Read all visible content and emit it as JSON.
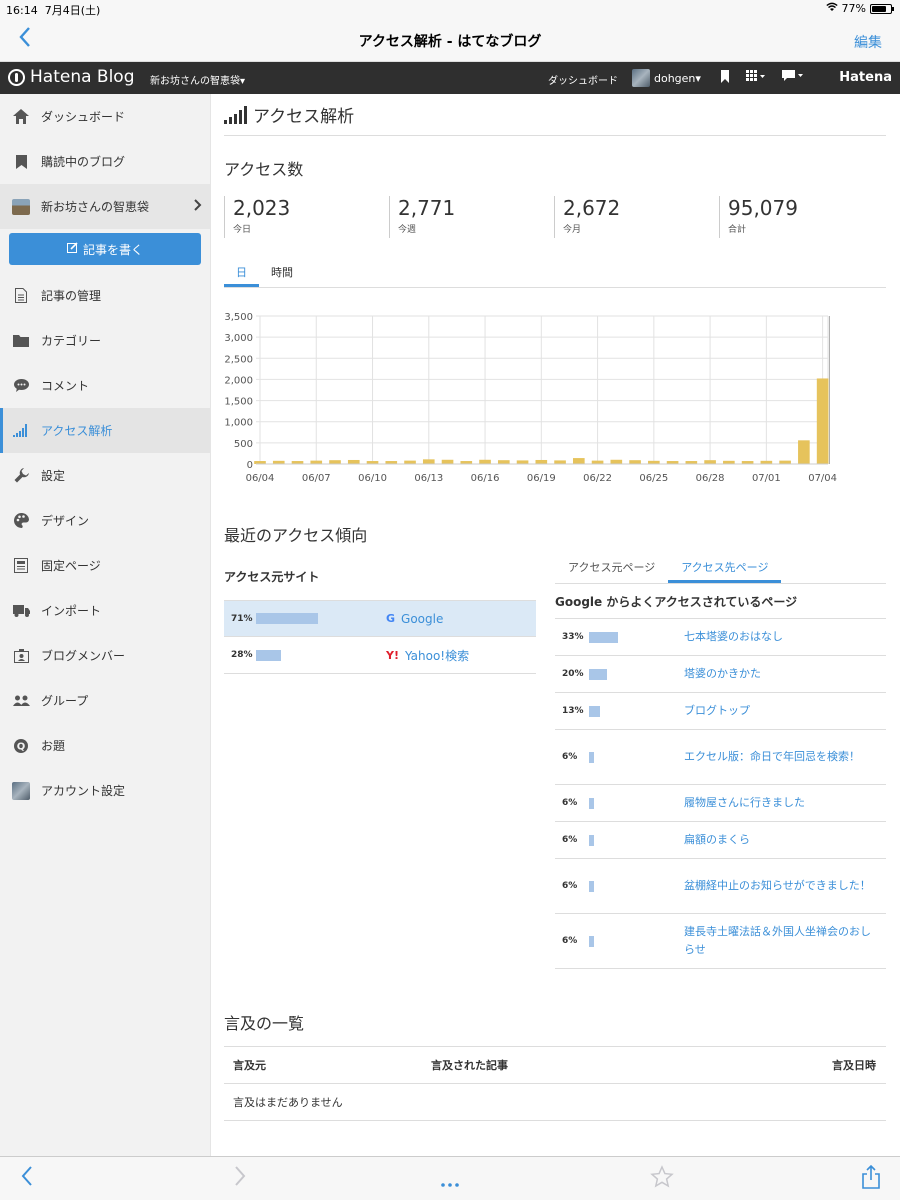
{
  "status": {
    "time": "16:14",
    "date": "7月4日(土)",
    "battery": "77%",
    "battery_level": 0.77
  },
  "nav": {
    "title": "アクセス解析 - はてなブログ",
    "edit": "編集",
    "back_icon": "chevron-left-icon"
  },
  "header": {
    "logo": "Hatena Blog",
    "blog_name": "新お坊さんの智恵袋▾",
    "dashboard": "ダッシュボード",
    "user": "dohgen▾",
    "brand": "Hatena"
  },
  "sidebar": {
    "items": [
      {
        "label": "ダッシュボード",
        "icon": "home-icon"
      },
      {
        "label": "購読中のブログ",
        "icon": "bookmark-icon"
      },
      {
        "label": "新お坊さんの智恵袋",
        "icon": "blog-thumbnail"
      },
      {
        "label": "記事の管理",
        "icon": "document-icon"
      },
      {
        "label": "カテゴリー",
        "icon": "folder-icon"
      },
      {
        "label": "コメント",
        "icon": "comment-icon"
      },
      {
        "label": "アクセス解析",
        "icon": "signal-icon",
        "active": true
      },
      {
        "label": "設定",
        "icon": "wrench-icon"
      },
      {
        "label": "デザイン",
        "icon": "palette-icon"
      },
      {
        "label": "固定ページ",
        "icon": "page-icon"
      },
      {
        "label": "インポート",
        "icon": "truck-icon"
      },
      {
        "label": "ブログメンバー",
        "icon": "member-icon"
      },
      {
        "label": "グループ",
        "icon": "group-icon"
      },
      {
        "label": "お題",
        "icon": "question-icon"
      },
      {
        "label": "アカウント設定",
        "icon": "avatar"
      }
    ],
    "write_button": "記事を書く"
  },
  "main": {
    "title": "アクセス解析",
    "access_heading": "アクセス数",
    "stats": [
      {
        "value": "2,023",
        "label": "今日"
      },
      {
        "value": "2,771",
        "label": "今週"
      },
      {
        "value": "2,672",
        "label": "今月"
      },
      {
        "value": "95,079",
        "label": "合計"
      }
    ],
    "tabs": [
      "日",
      "時間"
    ],
    "trend_heading": "最近のアクセス傾向",
    "sources_heading": "アクセス元サイト",
    "sources": [
      {
        "pct": "71%",
        "value": 71,
        "name": "Google",
        "icon": "google-icon"
      },
      {
        "pct": "28%",
        "value": 28,
        "name": "Yahoo!検索",
        "icon": "yahoo-icon"
      }
    ],
    "right_tabs": [
      "アクセス元ページ",
      "アクセス先ページ"
    ],
    "dest_heading": "Google からよくアクセスされているページ",
    "destinations": [
      {
        "pct": "33%",
        "value": 33,
        "name": "七本塔婆のおはなし"
      },
      {
        "pct": "20%",
        "value": 20,
        "name": "塔婆のかきかた"
      },
      {
        "pct": "13%",
        "value": 13,
        "name": "ブログトップ"
      },
      {
        "pct": "6%",
        "value": 6,
        "name": "エクセル版：命日で年回忌を検索！"
      },
      {
        "pct": "6%",
        "value": 6,
        "name": "履物屋さんに行きました"
      },
      {
        "pct": "6%",
        "value": 6,
        "name": "扁額のまくら"
      },
      {
        "pct": "6%",
        "value": 6,
        "name": "盆棚経中止のお知らせができました！"
      },
      {
        "pct": "6%",
        "value": 6,
        "name": "建長寺土曜法話＆外国人坐禅会のおしらせ"
      }
    ],
    "mention_heading": "言及の一覧",
    "mention_cols": [
      "言及元",
      "言及された記事",
      "言及日時"
    ],
    "mention_empty": "言及はまだありません"
  },
  "toolbar": {
    "icons": [
      "back-icon",
      "forward-icon",
      "more-icon",
      "star-icon",
      "share-icon"
    ]
  },
  "colors": {
    "accent": "#3b8fd8",
    "bar": "#e6c35c",
    "source_bar": "#a9c6e8"
  },
  "chart_data": {
    "type": "bar",
    "categories": [
      "06/04",
      "06/05",
      "06/06",
      "06/07",
      "06/08",
      "06/09",
      "06/10",
      "06/11",
      "06/12",
      "06/13",
      "06/14",
      "06/15",
      "06/16",
      "06/17",
      "06/18",
      "06/19",
      "06/20",
      "06/21",
      "06/22",
      "06/23",
      "06/24",
      "06/25",
      "06/26",
      "06/27",
      "06/28",
      "06/29",
      "06/30",
      "07/01",
      "07/02",
      "07/03",
      "07/04"
    ],
    "tick_labels": [
      "06/04",
      "06/07",
      "06/10",
      "06/13",
      "06/16",
      "06/19",
      "06/22",
      "06/25",
      "06/28",
      "07/01",
      "07/04"
    ],
    "values": [
      70,
      75,
      70,
      80,
      90,
      95,
      70,
      70,
      80,
      110,
      100,
      70,
      100,
      90,
      85,
      95,
      85,
      140,
      80,
      100,
      90,
      75,
      70,
      70,
      90,
      75,
      70,
      75,
      80,
      560,
      2023
    ],
    "ylim": [
      0,
      3500
    ],
    "yticks": [
      "0",
      "500",
      "1,000",
      "1,500",
      "2,000",
      "2,500",
      "3,000",
      "3,500"
    ],
    "grid": true
  }
}
